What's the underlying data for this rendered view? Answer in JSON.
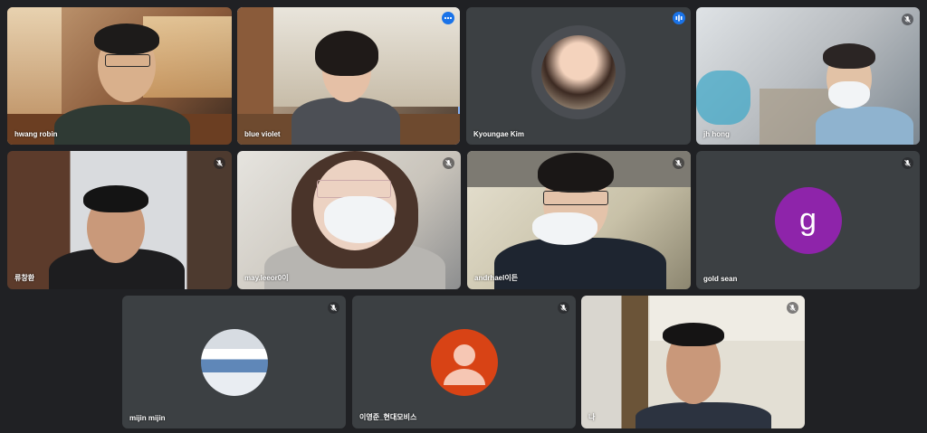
{
  "participants": [
    {
      "name": "hwang robin"
    },
    {
      "name": "blue violet"
    },
    {
      "name": "Kyoungae Kim"
    },
    {
      "name": "jh hong"
    },
    {
      "name": "류창환"
    },
    {
      "name": "may.leeor0이"
    },
    {
      "name": "andrhael이든"
    },
    {
      "name": "gold sean",
      "avatar_letter": "g",
      "avatar_color": "#8e24aa"
    },
    {
      "name": "mijin mijin"
    },
    {
      "name": "이영준_현대모비스",
      "avatar_color": "#d84315"
    },
    {
      "name": "나"
    }
  ],
  "colors": {
    "background": "#202124",
    "tile": "#3c4043",
    "active_border": "#8ab4f8",
    "accent": "#1a73e8"
  },
  "icons": {
    "muted": "mic-off-icon",
    "more": "more-options-icon",
    "speaking": "speaking-indicator-icon"
  }
}
